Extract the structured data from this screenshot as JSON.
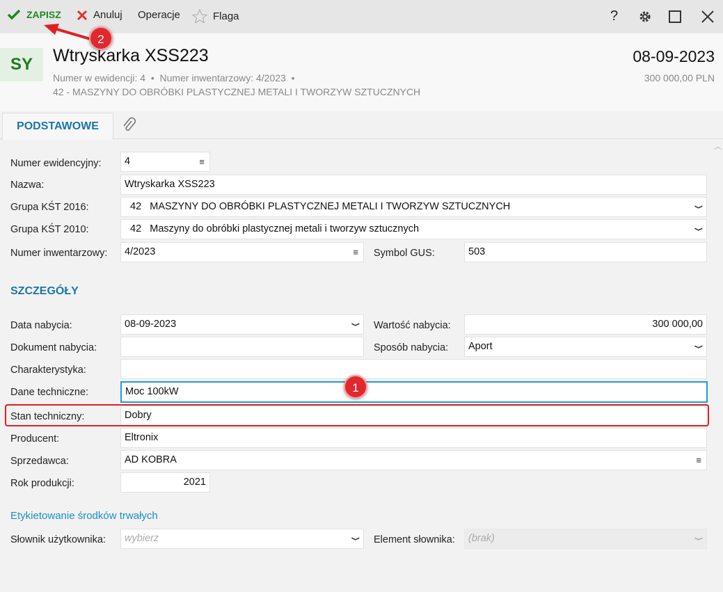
{
  "toolbar": {
    "save": "ZAPISZ",
    "cancel": "Anuluj",
    "operations": "Operacje",
    "flag": "Flaga"
  },
  "header": {
    "avatar": "SY",
    "title": "Wtryskarka XSS223",
    "sub1": "Numer w ewidencji: 4  •  Numer inwentarzowy: 4/2023  •",
    "sub2": "42 - MASZYNY DO OBRÓBKI PLASTYCZNEJ METALI I TWORZYW SZTUCZNYCH",
    "date": "08-09-2023",
    "amount": "300 000,00 PLN"
  },
  "tabs": {
    "basic": "PODSTAWOWE"
  },
  "form": {
    "numer_ewid": {
      "label": "Numer ewidencyjny:",
      "value": "4"
    },
    "nazwa": {
      "label": "Nazwa:",
      "value": "Wtryskarka XSS223"
    },
    "kst2016": {
      "label": "Grupa KŚT 2016:",
      "code": "42",
      "value": "MASZYNY DO OBRÓBKI PLASTYCZNEJ METALI I TWORZYW SZTUCZNYCH"
    },
    "kst2010": {
      "label": "Grupa KŚT 2010:",
      "code": "42",
      "value": "Maszyny do obróbki plastycznej metali i tworzyw sztucznych"
    },
    "numer_inw": {
      "label": "Numer inwentarzowy:",
      "value": "4/2023"
    },
    "gus": {
      "label": "Symbol GUS:",
      "value": "503"
    }
  },
  "details": {
    "title": "SZCZEGÓŁY",
    "data_nabycia": {
      "label": "Data nabycia:",
      "value": "08-09-2023"
    },
    "wartosc": {
      "label": "Wartość nabycia:",
      "value": "300 000,00"
    },
    "dokument": {
      "label": "Dokument nabycia:",
      "value": ""
    },
    "sposob": {
      "label": "Sposób nabycia:",
      "value": "Aport"
    },
    "charakterystyka": {
      "label": "Charakterystyka:",
      "value": ""
    },
    "dane_tech": {
      "label": "Dane techniczne:",
      "value": "Moc 100kW"
    },
    "stan": {
      "label": "Stan techniczny:",
      "value": "Dobry"
    },
    "producent": {
      "label": "Producent:",
      "value": "Eltronix"
    },
    "sprzedawca": {
      "label": "Sprzedawca:",
      "value": "AD KOBRA"
    },
    "rok": {
      "label": "Rok produkcji:",
      "value": "2021"
    }
  },
  "labels": {
    "title": "Etykietowanie środków trwałych",
    "slownik": {
      "label": "Słownik użytkownika:",
      "placeholder": "wybierz"
    },
    "element": {
      "label": "Element słownika:",
      "placeholder": "(brak)"
    }
  },
  "annotations": {
    "a1": "1",
    "a2": "2"
  }
}
